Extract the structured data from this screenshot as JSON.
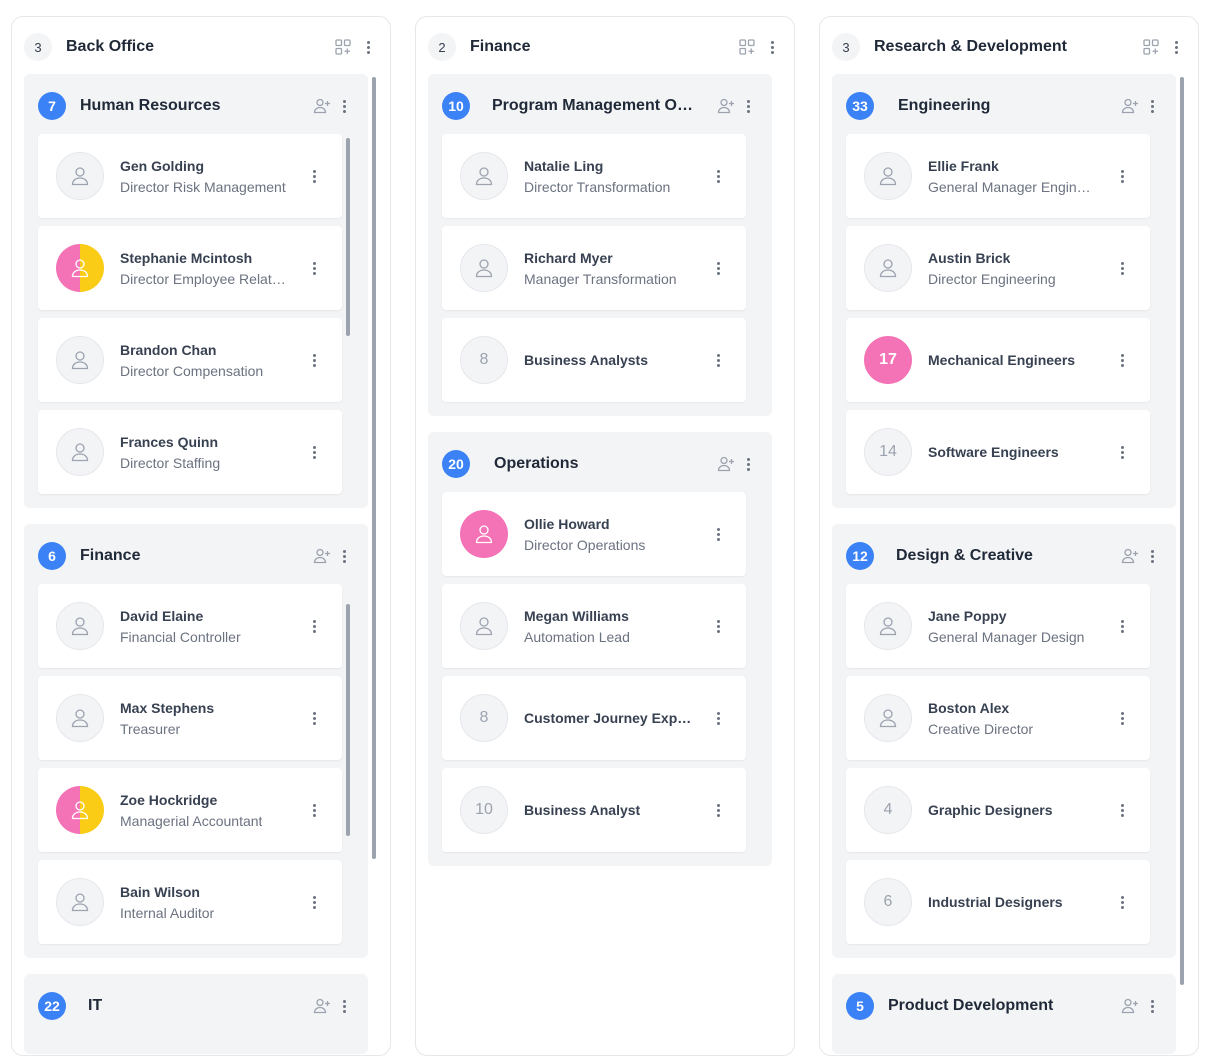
{
  "columns": [
    {
      "count": "3",
      "title": "Back Office",
      "groups": [
        {
          "count": "7",
          "title": "Human Resources",
          "cards": [
            {
              "name": "Gen Golding",
              "role": "Director Risk Management"
            },
            {
              "name": "Stephanie Mcintosh",
              "role": "Director Employee Relations"
            },
            {
              "name": "Brandon Chan",
              "role": "Director Compensation"
            },
            {
              "name": "Frances Quinn",
              "role": "Director Staffing"
            }
          ]
        },
        {
          "count": "6",
          "title": "Finance",
          "cards": [
            {
              "name": "David Elaine",
              "role": "Financial Controller"
            },
            {
              "name": "Max Stephens",
              "role": "Treasurer"
            },
            {
              "name": "Zoe Hockridge",
              "role": "Managerial Accountant"
            },
            {
              "name": "Bain Wilson",
              "role": "Internal Auditor"
            }
          ]
        },
        {
          "count": "22",
          "title": "IT",
          "cards": []
        }
      ]
    },
    {
      "count": "2",
      "title": "Finance",
      "groups": [
        {
          "count": "10",
          "title": "Program Management Office",
          "cards": [
            {
              "name": "Natalie Ling",
              "role": "Director Transformation"
            },
            {
              "name": "Richard Myer",
              "role": "Manager Transformation"
            },
            {
              "count": "8",
              "name": "Business Analysts"
            }
          ]
        },
        {
          "count": "20",
          "title": "Operations",
          "cards": [
            {
              "name": "Ollie Howard",
              "role": "Director Operations"
            },
            {
              "name": "Megan Williams",
              "role": "Automation Lead"
            },
            {
              "count": "8",
              "name": "Customer Journey Experts"
            },
            {
              "count": "10",
              "name": "Business Analyst"
            }
          ]
        }
      ]
    },
    {
      "count": "3",
      "title": "Research & Development",
      "groups": [
        {
          "count": "33",
          "title": "Engineering",
          "cards": [
            {
              "name": "Ellie Frank",
              "role": "General Manager Engineering"
            },
            {
              "name": "Austin Brick",
              "role": "Director Engineering"
            },
            {
              "count": "17",
              "name": "Mechanical Engineers"
            },
            {
              "count": "14",
              "name": "Software Engineers"
            }
          ]
        },
        {
          "count": "12",
          "title": "Design & Creative",
          "cards": [
            {
              "name": "Jane Poppy",
              "role": "General Manager Design"
            },
            {
              "name": "Boston Alex",
              "role": "Creative Director"
            },
            {
              "count": "4",
              "name": "Graphic Designers"
            },
            {
              "count": "6",
              "name": "Industrial Designers"
            }
          ]
        },
        {
          "count": "5",
          "title": "Product Development",
          "cards": []
        }
      ]
    }
  ],
  "colors": {
    "badge_blue": "#3b82f6",
    "avatar_pink": "#f472b6",
    "avatar_yellow": "#facc15"
  },
  "icons": {
    "column_grid": "grid-add-icon",
    "group_add": "add-user-icon",
    "more": "kebab-menu-icon",
    "person": "user-icon"
  }
}
